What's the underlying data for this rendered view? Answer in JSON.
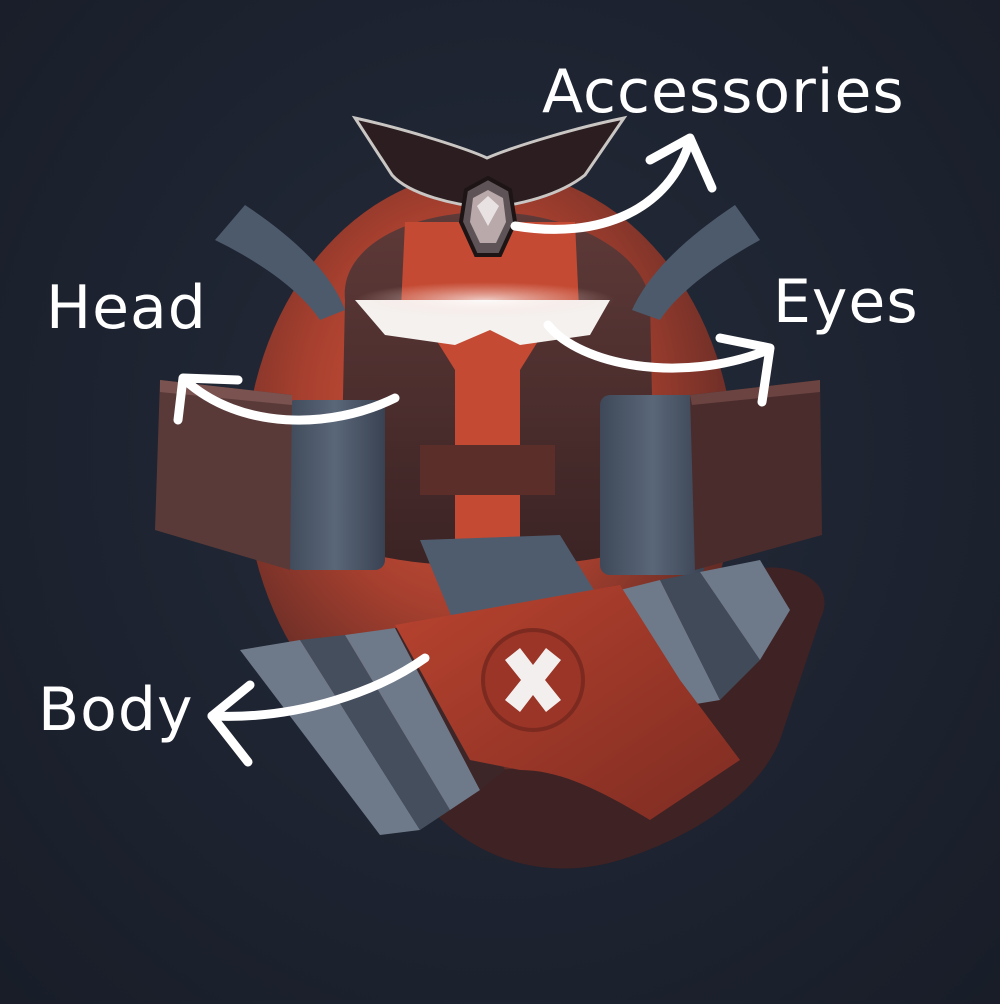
{
  "labels": {
    "accessories": "Accessories",
    "head": "Head",
    "eyes": "Eyes",
    "body": "Body"
  },
  "colors": {
    "background": "#1d2330",
    "armor_red": "#c8452f",
    "armor_dark": "#5a3534",
    "armor_steel": "#4f5c6e",
    "arrow": "#ffffff"
  },
  "icons": {
    "gem": "hexagonal-gem-icon",
    "emblem": "cross-x-icon"
  }
}
